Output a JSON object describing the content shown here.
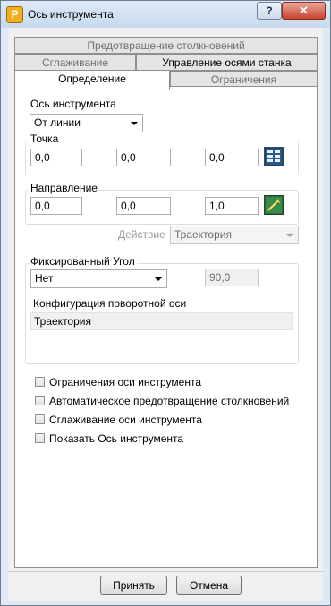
{
  "window": {
    "title": "Ось инструмента",
    "app_icon_letter": "P",
    "help_label": "?",
    "close_label": "✕"
  },
  "tabs": {
    "row1": [
      "Предотвращение столкновений"
    ],
    "row2": [
      "Сглаживание",
      "Управление осями станка"
    ],
    "row3": [
      "Определение",
      "Ограничения"
    ],
    "active": "Определение"
  },
  "definition": {
    "tool_axis_label": "Ось инструмента",
    "tool_axis_value": "От линии",
    "point": {
      "title": "Точка",
      "x": "0,0",
      "y": "0,0",
      "z": "0,0"
    },
    "direction": {
      "title": "Направление",
      "x": "0,0",
      "y": "0,0",
      "z": "1,0"
    },
    "action_label": "Действие",
    "action_value": "Траектория",
    "fixed_angle": {
      "title": "Фиксированный Угол",
      "mode_value": "Нет",
      "angle_value": "90,0",
      "rotary_config_label": "Конфигурация поворотной оси",
      "rotary_config_value": "Траектория"
    },
    "checkboxes": [
      {
        "label": "Ограничения оси инструмента",
        "checked": false
      },
      {
        "label": "Автоматическое предотвращение столкновений",
        "checked": false
      },
      {
        "label": "Сглаживание оси инструмента",
        "checked": false
      },
      {
        "label": "Показать Ось инструмента",
        "checked": false
      }
    ]
  },
  "footer": {
    "accept_label": "Принять",
    "cancel_label": "Отмена"
  }
}
